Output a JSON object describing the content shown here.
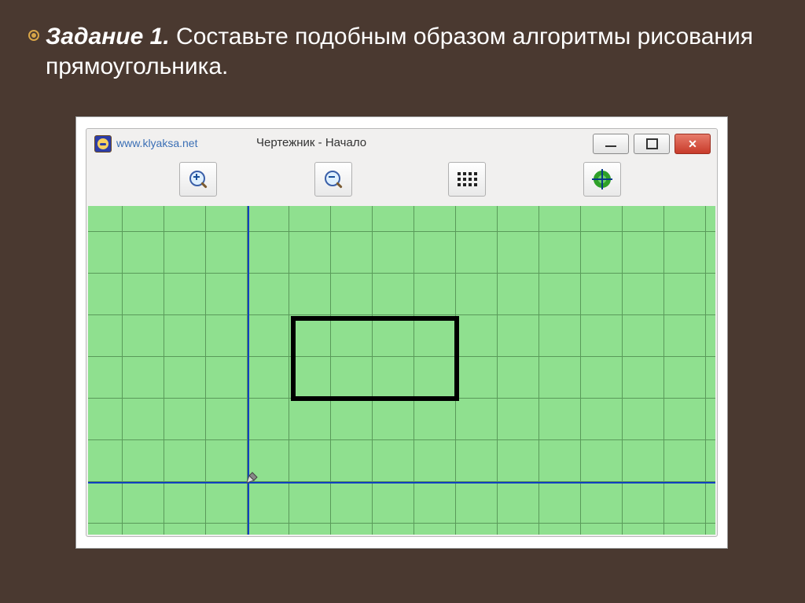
{
  "task": {
    "label_bold": "Задание 1.",
    "text_rest": " Составьте подобным образом алгоритмы рисования прямоугольника."
  },
  "window": {
    "url": "www.klyaksa.net",
    "title": "Чертежник - Начало",
    "toolbar": {
      "zoom_in": "zoom-in",
      "zoom_out": "zoom-out",
      "toggle_grid": "grid",
      "fit_view": "fit"
    }
  }
}
